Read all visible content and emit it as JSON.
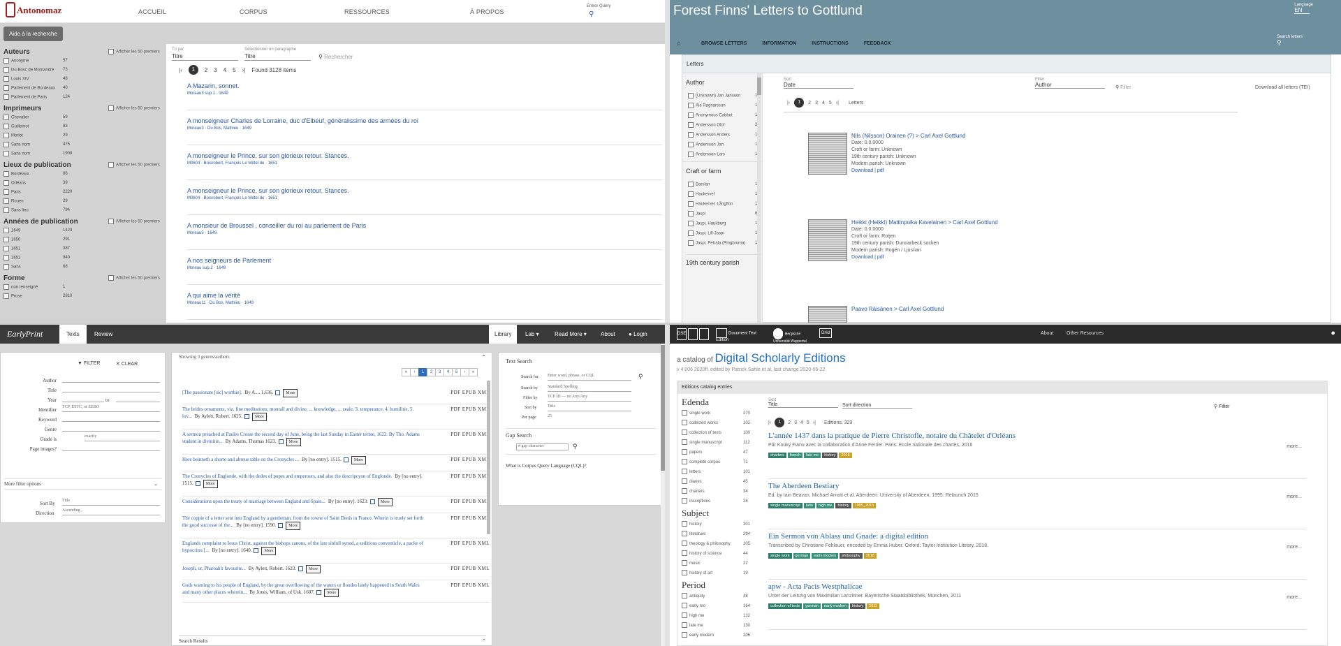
{
  "q1": {
    "logo": "Antonomaz",
    "nav": [
      "ACCUEIL",
      "CORPUS",
      "RESSOURCES",
      "À PROPOS"
    ],
    "user": "Entrer Query",
    "help_button": "Aide à la recherche",
    "sort_label": "Tri par",
    "sort_value": "Titre",
    "sort2_label": "Sélectionner un paragraphe",
    "sort2_value": "Titre",
    "search_placeholder": "Rechercher",
    "pages": [
      "1",
      "2",
      "3",
      "4",
      "5"
    ],
    "found": "Found 3128 items",
    "show_more": "Afficher les 50 premiers",
    "facets": [
      {
        "title": "Auteurs",
        "items": [
          {
            "label": "Anonyme",
            "count": "57"
          },
          {
            "label": "Du Bosc de Montandré",
            "count": "73"
          },
          {
            "label": "Louis XIV",
            "count": "48"
          },
          {
            "label": "Parlement de Bordeaux",
            "count": "40"
          },
          {
            "label": "Parlement de Paris",
            "count": "124"
          }
        ]
      },
      {
        "title": "Imprimeurs",
        "items": [
          {
            "label": "Chevalier",
            "count": "59"
          },
          {
            "label": "Guillemot",
            "count": "83"
          },
          {
            "label": "Morlot",
            "count": "29"
          },
          {
            "label": "Sans nom",
            "count": "475"
          },
          {
            "label": "Sans nom",
            "count": "1908"
          }
        ]
      },
      {
        "title": "Lieux de publication",
        "items": [
          {
            "label": "Bordeaux",
            "count": "86"
          },
          {
            "label": "Orléans",
            "count": "39"
          },
          {
            "label": "Paris",
            "count": "2220"
          },
          {
            "label": "Rouen",
            "count": "29"
          },
          {
            "label": "Sans lieu",
            "count": "794"
          }
        ]
      },
      {
        "title": "Années de publication",
        "items": [
          {
            "label": "1649",
            "count": "1423"
          },
          {
            "label": "1650",
            "count": "291"
          },
          {
            "label": "1651",
            "count": "387"
          },
          {
            "label": "1652",
            "count": "940"
          },
          {
            "label": "Sans",
            "count": "68"
          }
        ]
      },
      {
        "title": "Forme",
        "items": [
          {
            "label": "non renseigné",
            "count": "1"
          },
          {
            "label": "Prose",
            "count": "2810"
          }
        ]
      }
    ],
    "results": [
      {
        "title": "A Mazarin, sonnet.",
        "meta": "Moreau3 sup.1 · 1649"
      },
      {
        "title": "A monseigneur Charles de Lorraine, duc d'Elbeuf, généralissime des armées du roi",
        "meta": "Moreau3 · Du Bos, Mathieu · 1649"
      },
      {
        "title": "A monseigneur le Prince, sur son glorieux retour. Stances.",
        "meta": "M0604 · Boisrobert, François Le Métel de · 1651"
      },
      {
        "title": "A monseigneur le Prince, sur son glorieux retour. Stances.",
        "meta": "M0604 · Boisrobert, François Le Métel de · 1651"
      },
      {
        "title": "A monsieur de Broussel , conseiller du roi au parlement de Paris",
        "meta": "Moreau5 · 1649"
      },
      {
        "title": "A nos seigneurs de Parlement",
        "meta": "Moreau sup.2 · 1649"
      },
      {
        "title": "A qui aime la vérité",
        "meta": "Moreau11 · Du Bos, Mathieu · 1649"
      }
    ]
  },
  "q2": {
    "title": "Forest Finns' Letters to Gottlund",
    "lang_label": "Language",
    "lang_value": "EN",
    "nav": [
      "BROWSE LETTERS",
      "INFORMATION",
      "INSTRUCTIONS",
      "FEEDBACK"
    ],
    "search_label": "Search letters",
    "panel_title": "Letters",
    "author_facet": "Author",
    "authors": [
      {
        "label": "(Unknown) Jan Jansson",
        "count": "1"
      },
      {
        "label": "Ale Ragnarsson",
        "count": "1"
      },
      {
        "label": "Anonymous Cabbot",
        "count": "1"
      },
      {
        "label": "Andersson Olof",
        "count": "2"
      },
      {
        "label": "Andersson Anders",
        "count": "1"
      },
      {
        "label": "Andersson Jan",
        "count": "1"
      },
      {
        "label": "Andersson Lars",
        "count": "1"
      }
    ],
    "craft_facet": "Craft or farm",
    "crafts": [
      {
        "label": "Barslan",
        "count": "1"
      },
      {
        "label": "Haukervel",
        "count": "1"
      },
      {
        "label": "Haukervel, Långflon",
        "count": "1"
      },
      {
        "label": "Jaspi",
        "count": "6"
      },
      {
        "label": "Jaspi, Haukberg",
        "count": "1"
      },
      {
        "label": "Jaspi, Lill-Jaspi",
        "count": "1"
      },
      {
        "label": "Jaspi, Petrala (Ringbroma)",
        "count": "1"
      }
    ],
    "parish_facet": "19th century parish",
    "sort_label": "Sort",
    "sort_value": "Date",
    "filter_label": "Filter",
    "filter_value": "Author",
    "filter_placeholder": "Filter",
    "download_all": "Download all letters (TEI)",
    "pages": [
      "1",
      "2",
      "3",
      "4",
      "5"
    ],
    "pages_info": "Letters",
    "letters": [
      {
        "title": "Nils (Nilsson) Orainen (?) > Carl Axel Gottlund",
        "date": "Date: 0.0.0000",
        "craft": "Croft or farm: Unknown",
        "parish19": "19th century parish: Unknown",
        "modern": "Modern parish: Unknown",
        "download": "Download | pdf"
      },
      {
        "title": "Heikki (Heikki) Mattinpoika Kavelainen > Carl Axel Gottlund",
        "date": "Date: 0.0.0000",
        "craft": "Croft or farm: Rotjen",
        "parish19": "19th century parish: Dunnarbeck socken",
        "modern": "Modern parish: Rogen / Ljusnan",
        "download": "Download | pdf"
      },
      {
        "title": "Paavo Räisänen > Carl Axel Gottlund",
        "date": "",
        "craft": "",
        "parish19": "",
        "modern": "",
        "download": ""
      }
    ]
  },
  "q3": {
    "logo": "EarlyPrint",
    "tabs": [
      "Texts",
      "Review"
    ],
    "right_nav": [
      "Library",
      "Lab",
      "Read More",
      "About",
      "Login"
    ],
    "filter_btn": "FILTER",
    "clear_btn": "CLEAR",
    "fields": [
      {
        "label": "Author",
        "value": ""
      },
      {
        "label": "Title",
        "value": ""
      },
      {
        "label": "Year",
        "value": ""
      },
      {
        "label": "Identifier",
        "value": "TCP, ESTC, or EEBO"
      },
      {
        "label": "Keyword",
        "value": ""
      },
      {
        "label": "Genre",
        "value": ""
      },
      {
        "label": "Grade is",
        "value": "exactly"
      },
      {
        "label": "Page images?",
        "value": ""
      }
    ],
    "year_to": "to",
    "more_filter": "More filter options",
    "sort_by_label": "Sort By",
    "sort_by_value": "Title",
    "direction_label": "Direction",
    "direction_value": "Ascending",
    "list_header": "Showing 3 genres/authors",
    "pages": [
      "«",
      "‹",
      "1",
      "2",
      "3",
      "4",
      "5",
      "›",
      "»"
    ],
    "formats": "PDF   EPUB   XML",
    "more_label": "More",
    "rows": [
      {
        "text": "[The passionate [sic] worthie].",
        "by": "By A.... 1,636."
      },
      {
        "text": "The brides ornaments, viz. fine meditations, mourall and divine, ... knowledge, ... zeale, 3. temperance, 4. humilitie, 5. lov...",
        "by": "By Aylett, Robert. 1625."
      },
      {
        "text": "A sermon preached at Paules Crosse the second day of June, being the last Sunday in Easter terme, 1622. By Tho. Adams student in divinitie...",
        "by": "By Adams, Thomas 1623."
      },
      {
        "text": "Here beinneth a shorte and abreue table on the Cronycles ...",
        "by": "By [no entry]. 1515."
      },
      {
        "text": "The Cronycles of Englonde, with the dedes of popes and emperours, and also the descripcyon of Englonde.",
        "by": "By [no entry]. 1515."
      },
      {
        "text": "Considerations upon the treaty of marriage between England and Spain...",
        "by": "By [no entry]. 1623."
      },
      {
        "text": "The coppie of a letter sent into England by a gentleman, from the towne of Saint Denis in France. Wherin is truely set forth the good successe of the...",
        "by": "By [no entry]. 1590."
      },
      {
        "text": "Englands complaint to Iesus Christ, against the bishops canons, of the late sinfull synod, a seditious conventicle, a packe of hypocrites [...",
        "by": "By [no entry]. 1640."
      },
      {
        "text": "Joseph, or, Pharoah's favourite...",
        "by": "By Aylett, Robert. 1623."
      },
      {
        "text": "Gods warning to his people of England, by the great overflowing of the waters or floudes lately happened in South Wales and many other places wherein...",
        "by": "By Jones, William, of Usk. 1607."
      }
    ],
    "search_results_label": "Search Results",
    "text_search_title": "Text Search",
    "search_for_label": "Search for",
    "search_for_value": "Enter word, phrase, or CQL",
    "search_by_label": "Search by",
    "search_by_value": "Standard Spelling",
    "filter_by_label": "Filter by",
    "filter_by_value": "TCP ID — no Any/Any",
    "ts_sort_label": "Sort by",
    "ts_sort_value": "Title",
    "per_page_label": "Per page",
    "per_page_value": "25",
    "gap_search_title": "Gap Search",
    "gap_value": "# gap character",
    "cql_link": "What is Corpus Query Language (CQL)?"
  },
  "q4": {
    "brand_boxes": [
      "DSE",
      "",
      ""
    ],
    "brand_dte": "Document Text Edition",
    "brand_uni": "Bergische Universität Wuppertal",
    "brand_dh": "DHd",
    "nav": [
      "About",
      "Other Resources"
    ],
    "pre_title": "a catalog of",
    "title": "Digital Scholarly Editions",
    "sub": "v 4.006 2020ff, edited by Patrick Sahle et al, last change 2020-06-22",
    "panel_title": "Editions catalog entries",
    "facets": [
      {
        "title": "Edenda",
        "items": [
          {
            "label": "single work",
            "count": "270"
          },
          {
            "label": "collected works",
            "count": "102"
          },
          {
            "label": "collection of texts",
            "count": "100"
          },
          {
            "label": "single manuscript",
            "count": "112"
          },
          {
            "label": "papers",
            "count": "47"
          },
          {
            "label": "complete corpus",
            "count": "71"
          },
          {
            "label": "letters",
            "count": "101"
          },
          {
            "label": "diaries",
            "count": "45"
          },
          {
            "label": "charters",
            "count": "34"
          },
          {
            "label": "inscriptions",
            "count": "26"
          }
        ]
      },
      {
        "title": "Subject",
        "items": [
          {
            "label": "history",
            "count": "301"
          },
          {
            "label": "literature",
            "count": "294"
          },
          {
            "label": "theology & philosophy",
            "count": "105"
          },
          {
            "label": "history of science",
            "count": "44"
          },
          {
            "label": "music",
            "count": "22"
          },
          {
            "label": "history of art",
            "count": "19"
          }
        ]
      },
      {
        "title": "Period",
        "items": [
          {
            "label": "antiquity",
            "count": "48"
          },
          {
            "label": "early mo",
            "count": "164"
          },
          {
            "label": "high me",
            "count": "132"
          },
          {
            "label": "late me",
            "count": "130"
          },
          {
            "label": "early modern",
            "count": "205"
          }
        ]
      }
    ],
    "sort_label": "Sort",
    "sort_value": "Title",
    "direction_value": "Sort direction",
    "filter_label": "Filter",
    "pages": [
      "1",
      "2",
      "3",
      "4",
      "5"
    ],
    "editions_count": "Editions: 329",
    "more": "more...",
    "items": [
      {
        "title": "L'année 1437 dans la pratique de Pierre Christofle, notaire du Châtelet d'Orléans",
        "desc": "Par Kouky Fianu avec la collaboration d'Anne Ferrier. Paris: Ecole nationale des chartes, 2016",
        "tags": [
          {
            "t": "charters",
            "c": "#2e7d6b"
          },
          {
            "t": "french",
            "c": "#3a8f7a"
          },
          {
            "t": "late me",
            "c": "#3a8f7a"
          },
          {
            "t": "history",
            "c": "#555"
          },
          {
            "t": "2016",
            "c": "#c9a227"
          }
        ]
      },
      {
        "title": "The Aberdeen Bestiary",
        "desc": "Ed. by Iain Beavan, Michael Arnott et al. Aberdeen: University of Aberdeen, 1995. Relaunch 2015",
        "tags": [
          {
            "t": "single manuscript",
            "c": "#2e7d6b"
          },
          {
            "t": "latin",
            "c": "#3a8f7a"
          },
          {
            "t": "high me",
            "c": "#3a8f7a"
          },
          {
            "t": "history",
            "c": "#555"
          },
          {
            "t": "1995_2015",
            "c": "#c9a227"
          }
        ]
      },
      {
        "title": "Ein Sermon von Ablass und Gnade: a digital edition",
        "desc": "Transcribed by Christiane Fehlauer, encoded by Emma Huber. Oxford: Taylor Institution Library, 2018.",
        "tags": [
          {
            "t": "single work",
            "c": "#2e7d6b"
          },
          {
            "t": "german",
            "c": "#3a8f7a"
          },
          {
            "t": "early modern",
            "c": "#3a8f7a"
          },
          {
            "t": "philosophy",
            "c": "#555"
          },
          {
            "t": "2018",
            "c": "#c9a227"
          }
        ]
      },
      {
        "title": "apw - Acta Pacis Westphalicae",
        "desc": "Unter der Leitung von Maximilian Lanzinner. Bayerische Staatsbibliothek, München, 2011",
        "tags": [
          {
            "t": "collection of texts",
            "c": "#2e7d6b"
          },
          {
            "t": "german",
            "c": "#3a8f7a"
          },
          {
            "t": "early modern",
            "c": "#3a8f7a"
          },
          {
            "t": "history",
            "c": "#555"
          },
          {
            "t": "2011",
            "c": "#c9a227"
          }
        ]
      }
    ]
  }
}
